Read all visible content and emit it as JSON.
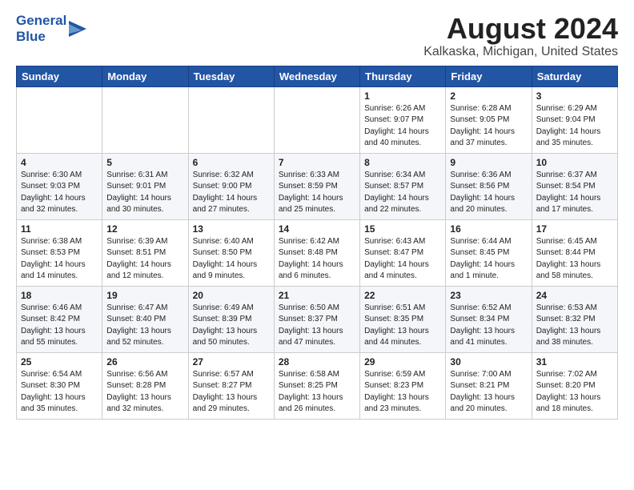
{
  "logo": {
    "line1": "General",
    "line2": "Blue"
  },
  "title": "August 2024",
  "subtitle": "Kalkaska, Michigan, United States",
  "weekdays": [
    "Sunday",
    "Monday",
    "Tuesday",
    "Wednesday",
    "Thursday",
    "Friday",
    "Saturday"
  ],
  "weeks": [
    [
      {
        "day": "",
        "info": ""
      },
      {
        "day": "",
        "info": ""
      },
      {
        "day": "",
        "info": ""
      },
      {
        "day": "",
        "info": ""
      },
      {
        "day": "1",
        "info": "Sunrise: 6:26 AM\nSunset: 9:07 PM\nDaylight: 14 hours\nand 40 minutes."
      },
      {
        "day": "2",
        "info": "Sunrise: 6:28 AM\nSunset: 9:05 PM\nDaylight: 14 hours\nand 37 minutes."
      },
      {
        "day": "3",
        "info": "Sunrise: 6:29 AM\nSunset: 9:04 PM\nDaylight: 14 hours\nand 35 minutes."
      }
    ],
    [
      {
        "day": "4",
        "info": "Sunrise: 6:30 AM\nSunset: 9:03 PM\nDaylight: 14 hours\nand 32 minutes."
      },
      {
        "day": "5",
        "info": "Sunrise: 6:31 AM\nSunset: 9:01 PM\nDaylight: 14 hours\nand 30 minutes."
      },
      {
        "day": "6",
        "info": "Sunrise: 6:32 AM\nSunset: 9:00 PM\nDaylight: 14 hours\nand 27 minutes."
      },
      {
        "day": "7",
        "info": "Sunrise: 6:33 AM\nSunset: 8:59 PM\nDaylight: 14 hours\nand 25 minutes."
      },
      {
        "day": "8",
        "info": "Sunrise: 6:34 AM\nSunset: 8:57 PM\nDaylight: 14 hours\nand 22 minutes."
      },
      {
        "day": "9",
        "info": "Sunrise: 6:36 AM\nSunset: 8:56 PM\nDaylight: 14 hours\nand 20 minutes."
      },
      {
        "day": "10",
        "info": "Sunrise: 6:37 AM\nSunset: 8:54 PM\nDaylight: 14 hours\nand 17 minutes."
      }
    ],
    [
      {
        "day": "11",
        "info": "Sunrise: 6:38 AM\nSunset: 8:53 PM\nDaylight: 14 hours\nand 14 minutes."
      },
      {
        "day": "12",
        "info": "Sunrise: 6:39 AM\nSunset: 8:51 PM\nDaylight: 14 hours\nand 12 minutes."
      },
      {
        "day": "13",
        "info": "Sunrise: 6:40 AM\nSunset: 8:50 PM\nDaylight: 14 hours\nand 9 minutes."
      },
      {
        "day": "14",
        "info": "Sunrise: 6:42 AM\nSunset: 8:48 PM\nDaylight: 14 hours\nand 6 minutes."
      },
      {
        "day": "15",
        "info": "Sunrise: 6:43 AM\nSunset: 8:47 PM\nDaylight: 14 hours\nand 4 minutes."
      },
      {
        "day": "16",
        "info": "Sunrise: 6:44 AM\nSunset: 8:45 PM\nDaylight: 14 hours\nand 1 minute."
      },
      {
        "day": "17",
        "info": "Sunrise: 6:45 AM\nSunset: 8:44 PM\nDaylight: 13 hours\nand 58 minutes."
      }
    ],
    [
      {
        "day": "18",
        "info": "Sunrise: 6:46 AM\nSunset: 8:42 PM\nDaylight: 13 hours\nand 55 minutes."
      },
      {
        "day": "19",
        "info": "Sunrise: 6:47 AM\nSunset: 8:40 PM\nDaylight: 13 hours\nand 52 minutes."
      },
      {
        "day": "20",
        "info": "Sunrise: 6:49 AM\nSunset: 8:39 PM\nDaylight: 13 hours\nand 50 minutes."
      },
      {
        "day": "21",
        "info": "Sunrise: 6:50 AM\nSunset: 8:37 PM\nDaylight: 13 hours\nand 47 minutes."
      },
      {
        "day": "22",
        "info": "Sunrise: 6:51 AM\nSunset: 8:35 PM\nDaylight: 13 hours\nand 44 minutes."
      },
      {
        "day": "23",
        "info": "Sunrise: 6:52 AM\nSunset: 8:34 PM\nDaylight: 13 hours\nand 41 minutes."
      },
      {
        "day": "24",
        "info": "Sunrise: 6:53 AM\nSunset: 8:32 PM\nDaylight: 13 hours\nand 38 minutes."
      }
    ],
    [
      {
        "day": "25",
        "info": "Sunrise: 6:54 AM\nSunset: 8:30 PM\nDaylight: 13 hours\nand 35 minutes."
      },
      {
        "day": "26",
        "info": "Sunrise: 6:56 AM\nSunset: 8:28 PM\nDaylight: 13 hours\nand 32 minutes."
      },
      {
        "day": "27",
        "info": "Sunrise: 6:57 AM\nSunset: 8:27 PM\nDaylight: 13 hours\nand 29 minutes."
      },
      {
        "day": "28",
        "info": "Sunrise: 6:58 AM\nSunset: 8:25 PM\nDaylight: 13 hours\nand 26 minutes."
      },
      {
        "day": "29",
        "info": "Sunrise: 6:59 AM\nSunset: 8:23 PM\nDaylight: 13 hours\nand 23 minutes."
      },
      {
        "day": "30",
        "info": "Sunrise: 7:00 AM\nSunset: 8:21 PM\nDaylight: 13 hours\nand 20 minutes."
      },
      {
        "day": "31",
        "info": "Sunrise: 7:02 AM\nSunset: 8:20 PM\nDaylight: 13 hours\nand 18 minutes."
      }
    ]
  ]
}
